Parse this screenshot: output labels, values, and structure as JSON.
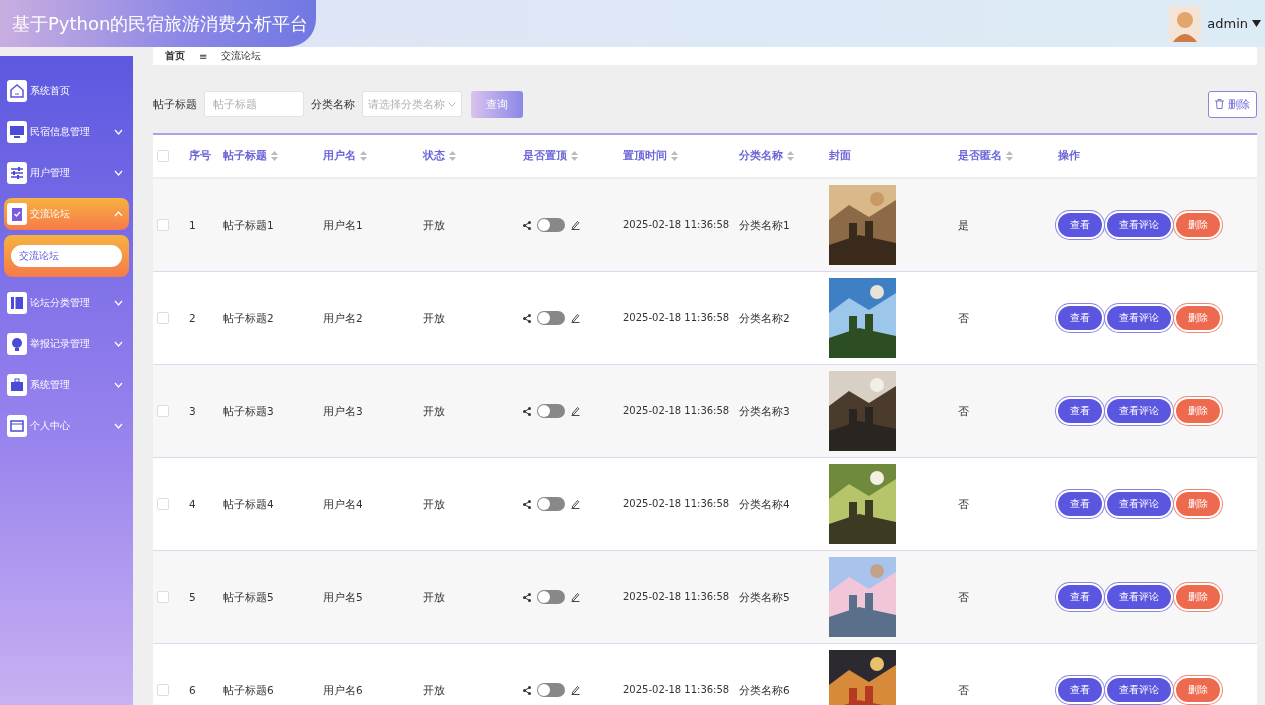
{
  "header": {
    "title": "基于Python的民宿旅游消费分析平台",
    "user": "admin"
  },
  "sidebar": {
    "items": [
      {
        "label": "系统首页",
        "selected": false
      },
      {
        "label": "民宿信息管理",
        "selected": false,
        "expanded": false
      },
      {
        "label": "用户管理",
        "selected": false,
        "expanded": false
      },
      {
        "label": "交流论坛",
        "selected": true,
        "expanded": true,
        "children": [
          {
            "label": "交流论坛",
            "selected": true
          }
        ]
      },
      {
        "label": "论坛分类管理",
        "selected": false,
        "expanded": false
      },
      {
        "label": "举报记录管理",
        "selected": false,
        "expanded": false
      },
      {
        "label": "系统管理",
        "selected": false,
        "expanded": false
      },
      {
        "label": "个人中心",
        "selected": false,
        "expanded": false
      }
    ]
  },
  "breadcrumb": [
    "首页",
    "交流论坛"
  ],
  "breadcrumb_separator": "≡",
  "filters": [
    {
      "label": "帖子标题",
      "kind": "text",
      "placeholder": "帖子标题"
    },
    {
      "label": "分类名称",
      "kind": "select",
      "placeholder": "请选择分类名称"
    }
  ],
  "search_button": "查询",
  "delete_button": "删除",
  "table": {
    "all_checked": false,
    "columns": [
      {
        "label": "序号",
        "sortable": false
      },
      {
        "label": "帖子标题",
        "sortable": true
      },
      {
        "label": "用户名",
        "sortable": true
      },
      {
        "label": "状态",
        "sortable": true
      },
      {
        "label": "是否置顶",
        "sortable": true
      },
      {
        "label": "置顶时间",
        "sortable": true
      },
      {
        "label": "分类名称",
        "sortable": true
      },
      {
        "label": "封面",
        "sortable": false
      },
      {
        "label": "是否匿名",
        "sortable": true
      },
      {
        "label": "操作",
        "sortable": false
      }
    ],
    "rows": [
      {
        "checked": false,
        "index": "1",
        "title": "帖子标题1",
        "user": "用户名1",
        "status": "开放",
        "pinned": false,
        "time": "2025-02-18 11:36:58",
        "category": "分类名称1",
        "anonymous": "是",
        "actions": [
          {
            "label": "查看",
            "kind": "primary"
          },
          {
            "label": "查看评论",
            "kind": "primary"
          },
          {
            "label": "删除",
            "kind": "danger"
          }
        ]
      },
      {
        "checked": false,
        "index": "2",
        "title": "帖子标题2",
        "user": "用户名2",
        "status": "开放",
        "pinned": false,
        "time": "2025-02-18 11:36:58",
        "category": "分类名称2",
        "anonymous": "否",
        "actions": [
          {
            "label": "查看",
            "kind": "primary"
          },
          {
            "label": "查看评论",
            "kind": "primary"
          },
          {
            "label": "删除",
            "kind": "danger"
          }
        ]
      },
      {
        "checked": false,
        "index": "3",
        "title": "帖子标题3",
        "user": "用户名3",
        "status": "开放",
        "pinned": false,
        "time": "2025-02-18 11:36:58",
        "category": "分类名称3",
        "anonymous": "否",
        "actions": [
          {
            "label": "查看",
            "kind": "primary"
          },
          {
            "label": "查看评论",
            "kind": "primary"
          },
          {
            "label": "删除",
            "kind": "danger"
          }
        ]
      },
      {
        "checked": false,
        "index": "4",
        "title": "帖子标题4",
        "user": "用户名4",
        "status": "开放",
        "pinned": false,
        "time": "2025-02-18 11:36:58",
        "category": "分类名称4",
        "anonymous": "否",
        "actions": [
          {
            "label": "查看",
            "kind": "primary"
          },
          {
            "label": "查看评论",
            "kind": "primary"
          },
          {
            "label": "删除",
            "kind": "danger"
          }
        ]
      },
      {
        "checked": false,
        "index": "5",
        "title": "帖子标题5",
        "user": "用户名5",
        "status": "开放",
        "pinned": false,
        "time": "2025-02-18 11:36:58",
        "category": "分类名称5",
        "anonymous": "否",
        "actions": [
          {
            "label": "查看",
            "kind": "primary"
          },
          {
            "label": "查看评论",
            "kind": "primary"
          },
          {
            "label": "删除",
            "kind": "danger"
          }
        ]
      },
      {
        "checked": false,
        "index": "6",
        "title": "帖子标题6",
        "user": "用户名6",
        "status": "开放",
        "pinned": false,
        "time": "2025-02-18 11:36:58",
        "category": "分类名称6",
        "anonymous": "否",
        "actions": [
          {
            "label": "查看",
            "kind": "primary"
          },
          {
            "label": "查看评论",
            "kind": "primary"
          },
          {
            "label": "删除",
            "kind": "danger"
          }
        ]
      }
    ]
  }
}
